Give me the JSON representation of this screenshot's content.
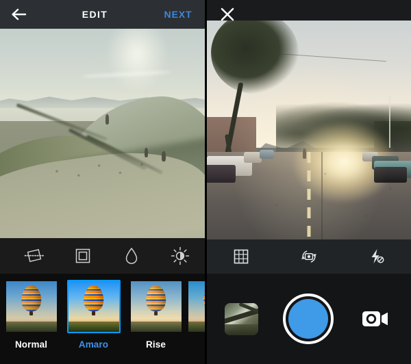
{
  "app": {
    "left_panel_name": "instagram-edit-screen",
    "right_panel_name": "instagram-camera-screen"
  },
  "theme": {
    "accent_blue": "#3d93e8",
    "next_blue": "#3d87d8",
    "selected_border": "#2d8fdd",
    "header_bg": "#2c3034",
    "toolbar_bg": "#1b1b1c",
    "camera_toolbar_bg": "#212427",
    "filter_strip_bg": "#0d0d0e",
    "camera_bar_bg": "#141517",
    "shutter_fill": "#3f9ae8",
    "text_white": "#ffffff"
  },
  "edit": {
    "header": {
      "back_icon": "back-arrow-icon",
      "title": "EDIT",
      "next_label": "NEXT"
    },
    "photo": {
      "name": "edit-photo-preview",
      "description": "Rolling green hills at golden hour with three people walking and long shadows"
    },
    "tools": [
      {
        "id": "adjust",
        "icon": "straighten-icon",
        "label": "Adjust"
      },
      {
        "id": "frame",
        "icon": "frame-icon",
        "label": "Frame"
      },
      {
        "id": "tilt-shift",
        "icon": "tilt-shift-drop-icon",
        "label": "Tilt Shift"
      },
      {
        "id": "lux",
        "icon": "brightness-sun-icon",
        "label": "Lux"
      }
    ],
    "filters": [
      {
        "id": "normal",
        "label": "Normal",
        "selected": false
      },
      {
        "id": "amaro",
        "label": "Amaro",
        "selected": true
      },
      {
        "id": "rise",
        "label": "Rise",
        "selected": false
      },
      {
        "id": "partial",
        "label": "",
        "selected": false
      }
    ]
  },
  "camera": {
    "close_icon": "close-x-icon",
    "viewfinder": {
      "name": "camera-viewfinder",
      "description": "City street at sunset with parked cars, trees and a person crossing the road"
    },
    "tools": [
      {
        "id": "grid",
        "icon": "grid-icon",
        "label": "Grid"
      },
      {
        "id": "flip",
        "icon": "camera-flip-icon",
        "label": "Switch Camera"
      },
      {
        "id": "flash",
        "icon": "flash-off-icon",
        "label": "Flash Off"
      }
    ],
    "bottom": {
      "gallery_name": "gallery-thumbnail",
      "shutter_name": "shutter-button",
      "video_icon": "video-camera-icon"
    }
  }
}
